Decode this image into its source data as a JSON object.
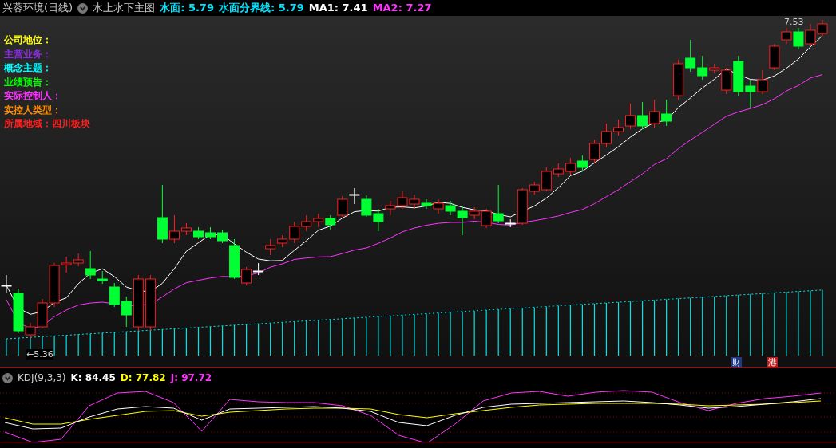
{
  "header": {
    "title": "兴蓉环境(日线)",
    "indicator": "水上水下主图",
    "readings": [
      {
        "text": "水面: 5.79",
        "color": "#00e5ff"
      },
      {
        "text": "水面分界线: 5.79",
        "color": "#00e5ff"
      },
      {
        "text": "MA1: 7.41",
        "color": "#ffffff"
      },
      {
        "text": "MA2: 7.27",
        "color": "#ff33ff"
      }
    ]
  },
  "info_lines": [
    {
      "text": "公司地位：",
      "color": "#ffff00"
    },
    {
      "text": "主营业务：",
      "color": "#8a2be2"
    },
    {
      "text": "概念主题：",
      "color": "#00ffff"
    },
    {
      "text": "业绩预告：",
      "color": "#00ff00"
    },
    {
      "text": "实际控制人：",
      "color": "#ff33ff"
    },
    {
      "text": "实控人类型：",
      "color": "#ff8c00"
    },
    {
      "text": "所属地域：四川板块",
      "color": "#ff2020"
    }
  ],
  "high_label": "7.53",
  "low_label": "←5.36",
  "badges": [
    {
      "text": "财",
      "color": "#1e3a8a"
    },
    {
      "text": "港",
      "color": "#b91c1c"
    }
  ],
  "kdj": {
    "title": "KDJ(9,3,3)",
    "readings": [
      {
        "text": "K: 84.45",
        "color": "#ffffff"
      },
      {
        "text": "D: 77.82",
        "color": "#ffff00"
      },
      {
        "text": "J: 97.72",
        "color": "#ff33ff"
      }
    ]
  }
}
